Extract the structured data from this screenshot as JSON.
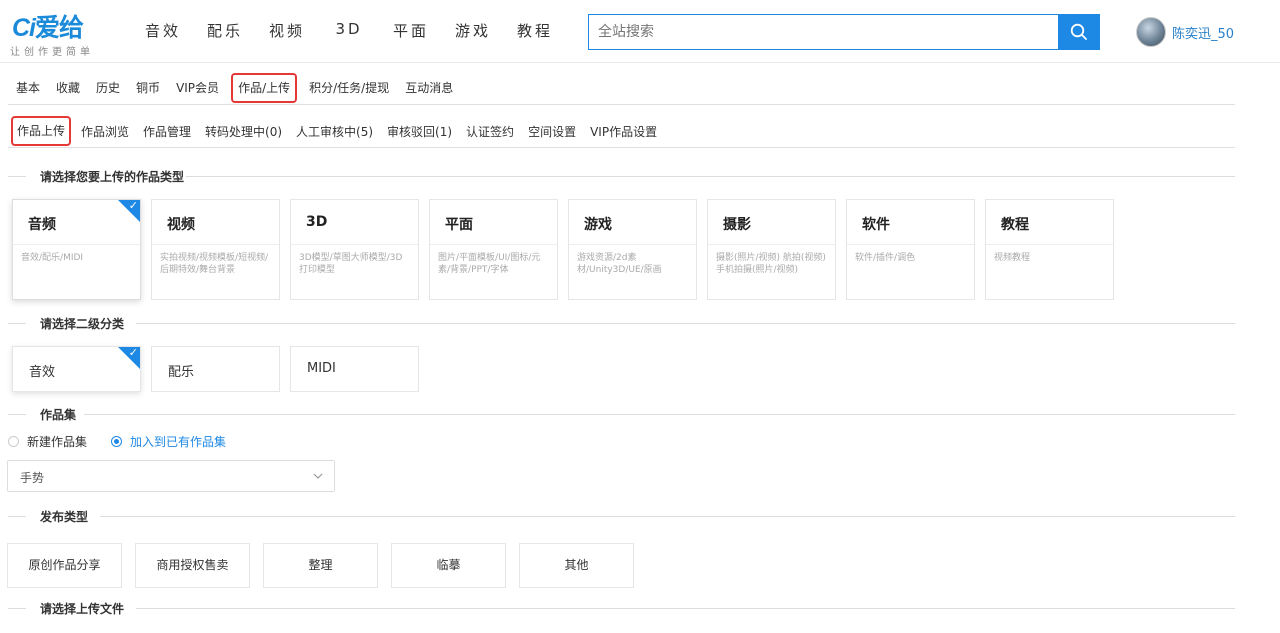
{
  "header": {
    "logo_mark": "Ci",
    "logo_text": "爱给",
    "slogan": "让创作更简单",
    "nav": [
      "音效",
      "配乐",
      "视频",
      "3D",
      "平面",
      "游戏",
      "教程"
    ],
    "search_placeholder": "全站搜索",
    "username": "陈奕迅_50"
  },
  "tabs_primary": [
    "基本",
    "收藏",
    "历史",
    "铜币",
    "VIP会员",
    "作品/上传",
    "积分/任务/提现",
    "互动消息"
  ],
  "tabs_primary_active": "作品/上传",
  "tabs_secondary": [
    "作品上传",
    "作品浏览",
    "作品管理",
    "转码处理中(0)",
    "人工审核中(5)",
    "审核驳回(1)",
    "认证签约",
    "空间设置",
    "VIP作品设置"
  ],
  "tabs_secondary_active": "作品上传",
  "section_type": "请选择您要上传的作品类型",
  "categories": [
    {
      "title": "音频",
      "desc": "音效/配乐/MIDI",
      "selected": true
    },
    {
      "title": "视频",
      "desc": "实拍视频/视频模板/短视频/后期特效/舞台背景",
      "selected": false
    },
    {
      "title": "3D",
      "desc": "3D模型/草图大师模型/3D打印模型",
      "selected": false
    },
    {
      "title": "平面",
      "desc": "图片/平面模板/UI/图标/元素/背景/PPT/字体",
      "selected": false
    },
    {
      "title": "游戏",
      "desc": "游戏资源/2d素材/Unity3D/UE/原画",
      "selected": false
    },
    {
      "title": "摄影",
      "desc": "摄影(照片/视频) 航拍(视频) 手机拍摄(照片/视频)",
      "selected": false
    },
    {
      "title": "软件",
      "desc": "软件/插件/调色",
      "selected": false
    },
    {
      "title": "教程",
      "desc": "视频教程",
      "selected": false
    }
  ],
  "section_subtype": "请选择二级分类",
  "subcategories": [
    {
      "label": "音效",
      "selected": true
    },
    {
      "label": "配乐",
      "selected": false
    },
    {
      "label": "MIDI",
      "selected": false
    }
  ],
  "section_collection": "作品集",
  "collection_options": [
    {
      "label": "新建作品集",
      "checked": false
    },
    {
      "label": "加入到已有作品集",
      "checked": true
    }
  ],
  "collection_select_value": "手势",
  "section_publish": "发布类型",
  "publish_types": [
    "原创作品分享",
    "商用授权售卖",
    "整理",
    "临摹",
    "其他"
  ],
  "section_upload": "请选择上传文件",
  "colors": {
    "accent": "#1e88e5",
    "highlight": "#e53935"
  }
}
